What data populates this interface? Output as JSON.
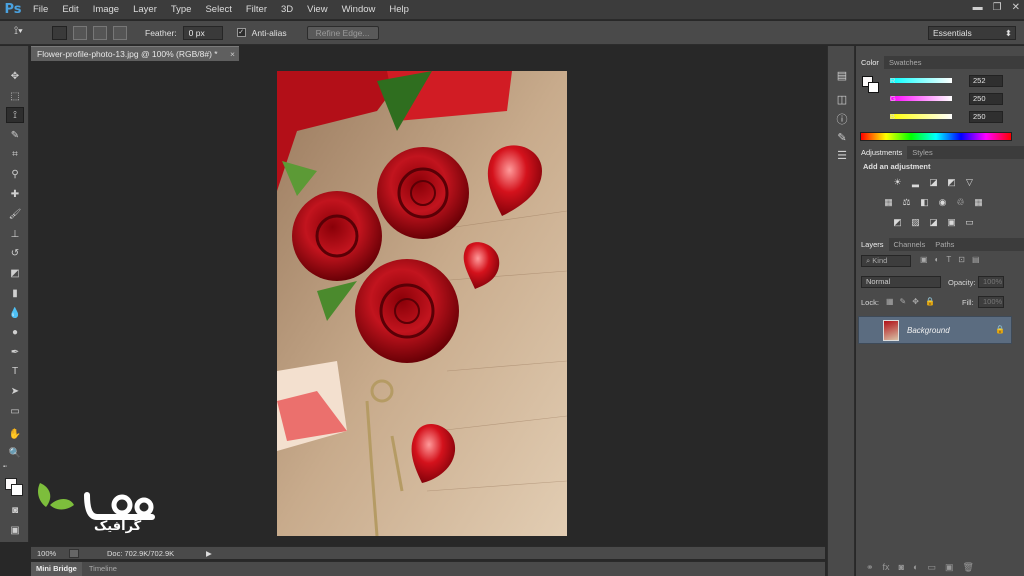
{
  "app": {
    "logo": "Ps"
  },
  "menu": [
    "File",
    "Edit",
    "Image",
    "Layer",
    "Type",
    "Select",
    "Filter",
    "3D",
    "View",
    "Window",
    "Help"
  ],
  "window_controls": {
    "minimize": "▬",
    "restore": "❐",
    "close": "✕"
  },
  "options": {
    "feather_label": "Feather:",
    "feather_value": "0 px",
    "antialias_label": "Anti-alias",
    "antialias_checked": true,
    "refine_edge": "Refine Edge...",
    "workspace": "Essentials"
  },
  "document": {
    "tab_title": "Flower-profile-photo-13.jpg @ 100% (RGB/8#) *",
    "close": "×",
    "zoom": "100%",
    "doc_info": "Doc: 702.9K/702.9K"
  },
  "bottom_tabs": [
    "Mini Bridge",
    "Timeline"
  ],
  "color_panel": {
    "tabs": [
      "Color",
      "Swatches"
    ],
    "sliders": [
      {
        "label": "R",
        "value": "252"
      },
      {
        "label": "G",
        "value": "250"
      },
      {
        "label": "B",
        "value": "250"
      }
    ]
  },
  "adjustments_panel": {
    "tabs": [
      "Adjustments",
      "Styles"
    ],
    "heading": "Add an adjustment"
  },
  "layers_panel": {
    "tabs": [
      "Layers",
      "Channels",
      "Paths"
    ],
    "kind": "Kind",
    "blend_mode": "Normal",
    "opacity_label": "Opacity:",
    "opacity_value": "100%",
    "lock_label": "Lock:",
    "fill_label": "Fill:",
    "fill_value": "100%",
    "layers": [
      {
        "name": "Background",
        "visible": true,
        "locked": true
      }
    ]
  },
  "watermark": {
    "text": "گرافیک"
  },
  "colors": {
    "ui_dark": "#282828",
    "panel": "#4a4a4a",
    "accent_blue": "#4aa2e0",
    "layer_selected": "#5b6c80",
    "watermark_green": "#7dbe3c"
  }
}
